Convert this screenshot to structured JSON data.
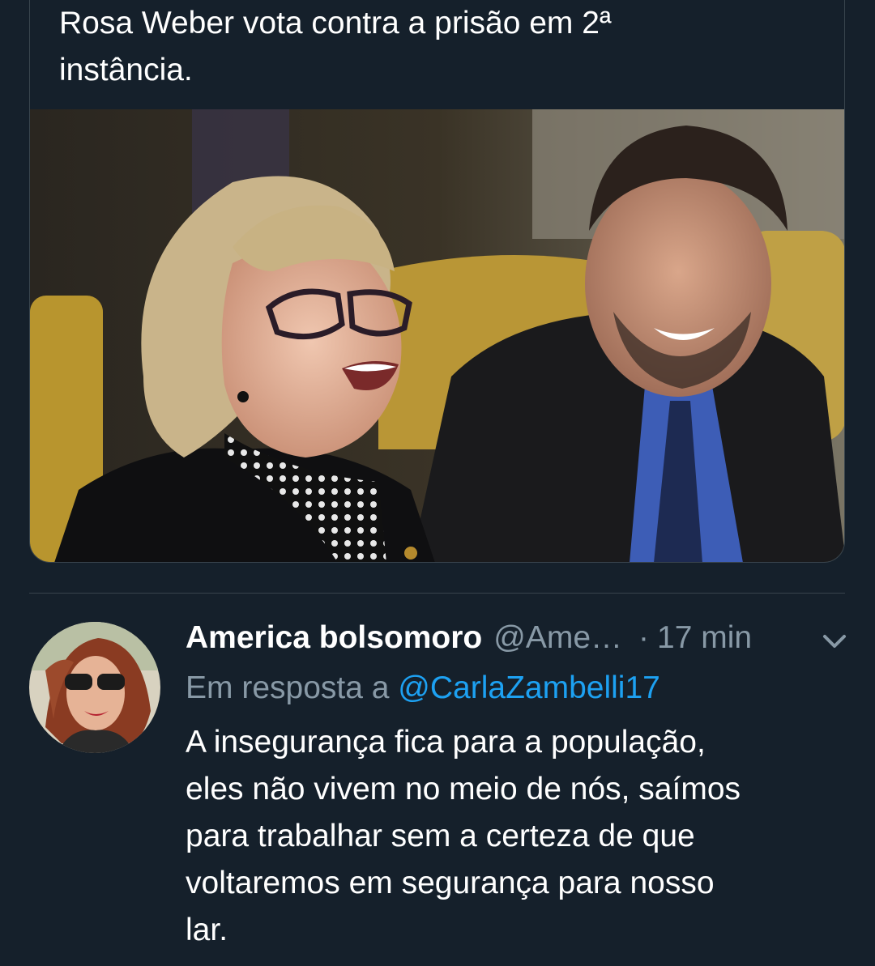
{
  "quoted_tweet": {
    "text_lines": [
      "Rosa Weber vota contra a prisão em 2ª",
      "instância."
    ],
    "image_description_icon": "photo"
  },
  "reply": {
    "author_name": "America bolsomoro",
    "author_handle": "@Ame…",
    "separator": "·",
    "timestamp": "17 min",
    "reply_to_label": "Em resposta a",
    "reply_to_handle": "@CarlaZambelli17",
    "body_lines": [
      "A insegurança fica para a população,",
      "eles não vivem no meio de nós, saímos",
      "para trabalhar sem a certeza de que",
      "voltaremos em segurança para nosso",
      "lar."
    ]
  },
  "colors": {
    "background": "#15202b",
    "border": "#38444d",
    "secondary_text": "#8899a6",
    "link": "#1da1f2",
    "primary_text": "#ffffff"
  },
  "icons": {
    "more": "chevron-down-icon"
  }
}
